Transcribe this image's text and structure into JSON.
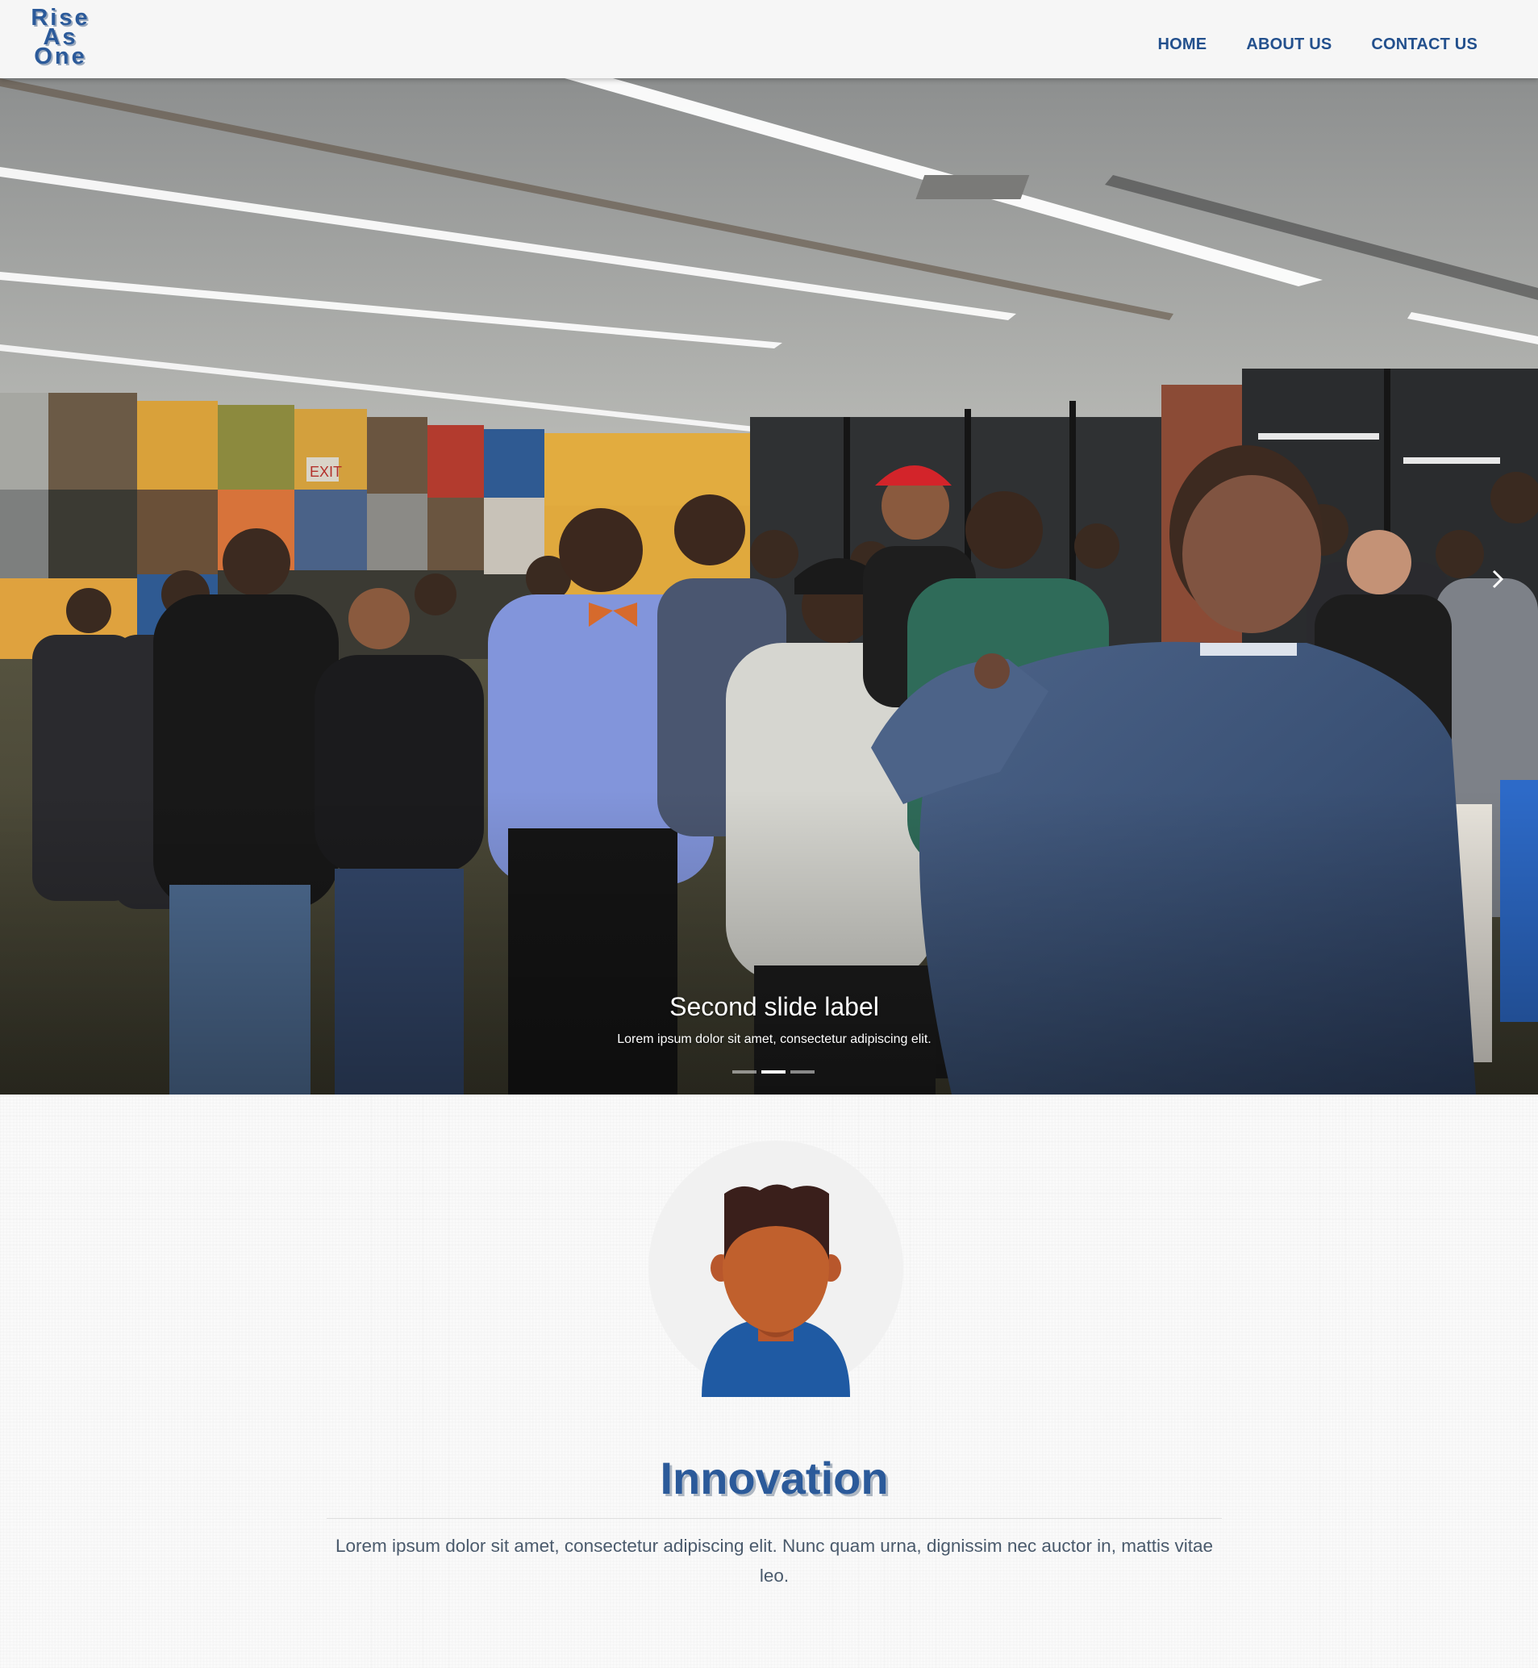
{
  "brand": {
    "logo_lines": [
      "Rise",
      "As",
      "One"
    ]
  },
  "nav": {
    "items": [
      {
        "label": "HOME"
      },
      {
        "label": "ABOUT US"
      },
      {
        "label": "CONTACT US"
      }
    ]
  },
  "carousel": {
    "slide_title": "Second slide label",
    "slide_text": "Lorem ipsum dolor sit amet, consectetur adipiscing elit.",
    "slide_count": 3,
    "active_index": 1,
    "next_icon": "chevron-right-icon"
  },
  "feature": {
    "icon": "person-avatar-icon",
    "title": "Innovation",
    "text": "Lorem ipsum dolor sit amet, consectetur adipiscing elit. Nunc quam urna, dignissim nec auctor in, mattis vitae leo."
  },
  "colors": {
    "brand_blue": "#2b5a9a",
    "nav_blue": "#23508d",
    "navbar_bg": "#f6f6f6",
    "body_text": "#4a5a6c"
  }
}
